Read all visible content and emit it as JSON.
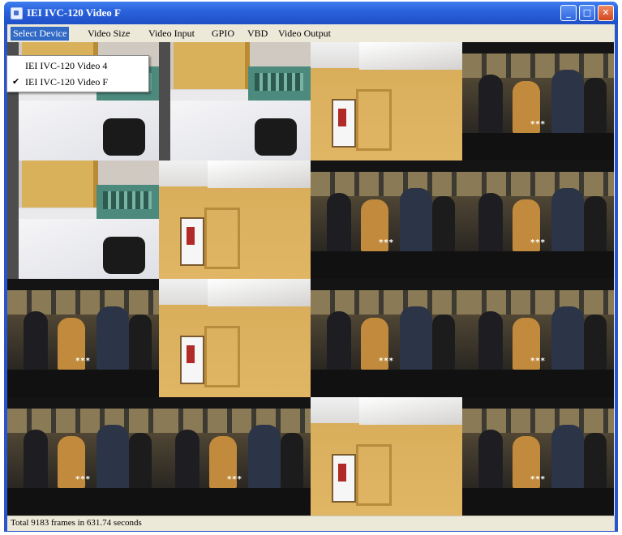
{
  "window": {
    "title": "IEI IVC-120 Video F",
    "buttons": {
      "minimize_glyph": "_",
      "maximize_glyph": "□",
      "close_glyph": "✕"
    }
  },
  "menubar": {
    "items": [
      {
        "label": "Select Device"
      },
      {
        "label": "Video Size"
      },
      {
        "label": "Video Input"
      },
      {
        "label": "GPIO"
      },
      {
        "label": "VBD"
      },
      {
        "label": "Video Output"
      }
    ]
  },
  "dropdown": {
    "items": [
      {
        "label": "IEI IVC-120 Video 4",
        "checked": false
      },
      {
        "label": "IEI IVC-120 Video F",
        "checked": true,
        "check_glyph": "✔"
      }
    ]
  },
  "video_tiles": [
    {
      "scene": "office-desk"
    },
    {
      "scene": "office-desk"
    },
    {
      "scene": "office-door"
    },
    {
      "scene": "people",
      "caption": "***"
    },
    {
      "scene": "office-desk"
    },
    {
      "scene": "office-door"
    },
    {
      "scene": "people",
      "caption": "***"
    },
    {
      "scene": "people",
      "caption": "***"
    },
    {
      "scene": "people",
      "caption": "***"
    },
    {
      "scene": "office-door"
    },
    {
      "scene": "people",
      "caption": "***"
    },
    {
      "scene": "people",
      "caption": "***"
    },
    {
      "scene": "people",
      "caption": "***"
    },
    {
      "scene": "people",
      "caption": "***"
    },
    {
      "scene": "office-door"
    },
    {
      "scene": "people",
      "caption": "***"
    }
  ],
  "statusbar": {
    "text": "Total 9183 frames in 631.74 seconds"
  },
  "colors": {
    "titlebar": "#2a63de",
    "menu_highlight": "#3169c6",
    "chrome": "#ece9d8",
    "close_button": "#d3471e"
  }
}
